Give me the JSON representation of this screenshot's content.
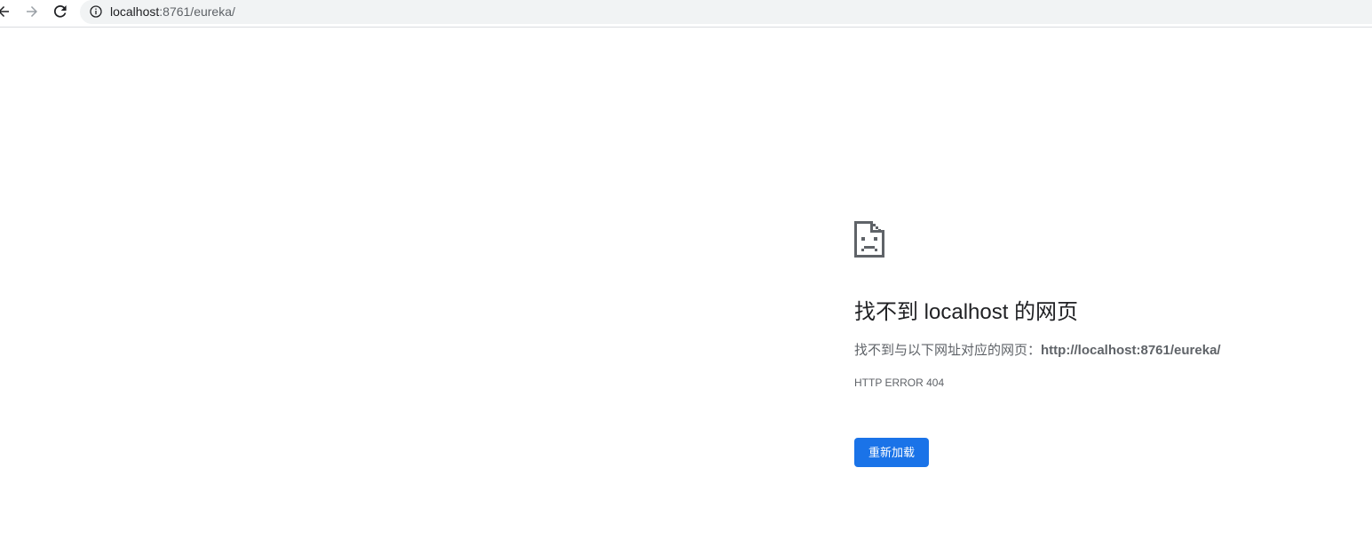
{
  "toolbar": {
    "back_icon": "back-arrow-icon",
    "forward_icon": "forward-arrow-icon",
    "reload_icon": "reload-icon",
    "site_info_icon": "info-icon",
    "url_host": "localhost",
    "url_rest": ":8761/eureka/"
  },
  "error_page": {
    "icon": "sad-document-icon",
    "heading": "找不到 localhost 的网页",
    "description_prefix": "找不到与以下网址对应的网页：",
    "description_url": "http://localhost:8761/eureka/",
    "error_code": "HTTP ERROR 404",
    "reload_label": "重新加载"
  },
  "colors": {
    "accent": "#1a73e8",
    "omnibox_bg": "#f1f3f4",
    "text_primary": "#202124",
    "text_secondary": "#5f6368"
  }
}
